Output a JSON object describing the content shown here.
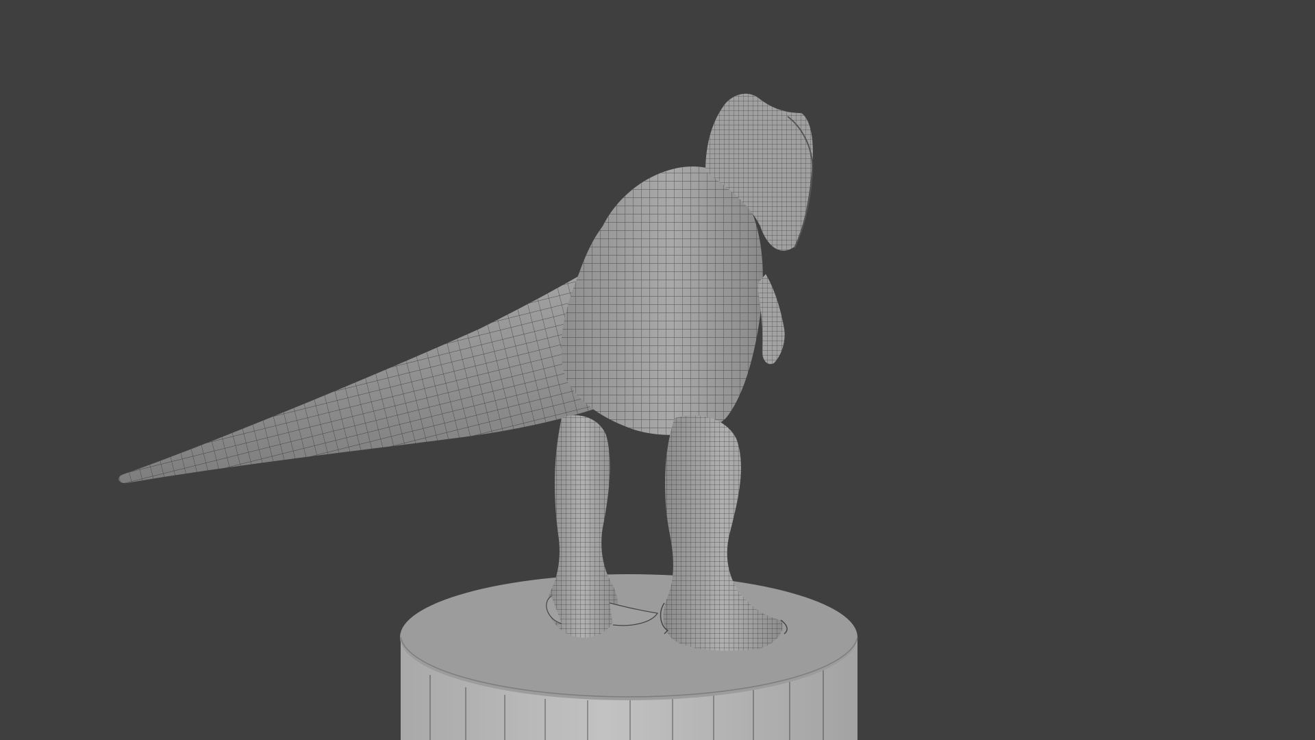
{
  "viewport": {
    "background_color": "#3f3f3f",
    "mesh_fill_color": "#9e9e9e",
    "mesh_shadow_color": "#6e6e6e",
    "wire_color": "#2b2b2b",
    "pedestal_top_color": "#9a9a9a",
    "pedestal_side_color": "#b9b9b9",
    "shading_mode": "solid-wireframe",
    "objects": [
      {
        "name": "trex-model",
        "type": "mesh"
      },
      {
        "name": "pedestal-cylinder",
        "type": "mesh"
      }
    ]
  }
}
